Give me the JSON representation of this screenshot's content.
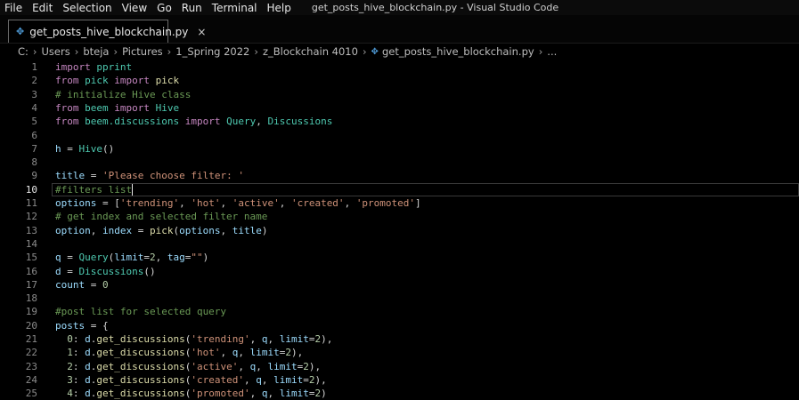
{
  "menu": [
    "File",
    "Edit",
    "Selection",
    "View",
    "Go",
    "Run",
    "Terminal",
    "Help"
  ],
  "window_title": "get_posts_hive_blockchain.py - Visual Studio Code",
  "tab": {
    "label": "get_posts_hive_blockchain.py",
    "close": "×",
    "icon": "python-file-icon"
  },
  "breadcrumb": [
    "C:",
    "Users",
    "bteja",
    "Pictures",
    "1_Spring 2022",
    "z_Blockchain 4010",
    "get_posts_hive_blockchain.py",
    "..."
  ],
  "colors": {
    "keyword": "#c586c0",
    "function": "#dcdcaa",
    "string": "#ce9178",
    "comment": "#6a9955",
    "number": "#b5cea8",
    "variable": "#9cdcfe",
    "class": "#4ec9b0"
  },
  "active_line": 10,
  "lines": [
    {
      "n": "1",
      "tokens": [
        [
          "kw",
          "import"
        ],
        [
          "plain",
          " "
        ],
        [
          "mod",
          "pprint"
        ]
      ]
    },
    {
      "n": "2",
      "tokens": [
        [
          "kw",
          "from"
        ],
        [
          "plain",
          " "
        ],
        [
          "mod",
          "pick"
        ],
        [
          "plain",
          " "
        ],
        [
          "kw",
          "import"
        ],
        [
          "plain",
          " "
        ],
        [
          "fn",
          "pick"
        ]
      ]
    },
    {
      "n": "3",
      "tokens": [
        [
          "cm",
          "# initialize Hive class"
        ]
      ]
    },
    {
      "n": "4",
      "tokens": [
        [
          "kw",
          "from"
        ],
        [
          "plain",
          " "
        ],
        [
          "mod",
          "beem"
        ],
        [
          "plain",
          " "
        ],
        [
          "kw",
          "import"
        ],
        [
          "plain",
          " "
        ],
        [
          "cls",
          "Hive"
        ]
      ]
    },
    {
      "n": "5",
      "tokens": [
        [
          "kw",
          "from"
        ],
        [
          "plain",
          " "
        ],
        [
          "mod",
          "beem.discussions"
        ],
        [
          "plain",
          " "
        ],
        [
          "kw",
          "import"
        ],
        [
          "plain",
          " "
        ],
        [
          "cls",
          "Query"
        ],
        [
          "plain",
          ", "
        ],
        [
          "cls",
          "Discussions"
        ]
      ]
    },
    {
      "n": "6",
      "tokens": []
    },
    {
      "n": "7",
      "tokens": [
        [
          "var",
          "h"
        ],
        [
          "plain",
          " = "
        ],
        [
          "cls",
          "Hive"
        ],
        [
          "plain",
          "()"
        ]
      ]
    },
    {
      "n": "8",
      "tokens": []
    },
    {
      "n": "9",
      "tokens": [
        [
          "var",
          "title"
        ],
        [
          "plain",
          " = "
        ],
        [
          "str",
          "'Please choose filter: '"
        ]
      ]
    },
    {
      "n": "10",
      "tokens": [
        [
          "cm",
          "#filters list"
        ]
      ]
    },
    {
      "n": "11",
      "tokens": [
        [
          "var",
          "options"
        ],
        [
          "plain",
          " = ["
        ],
        [
          "str",
          "'trending'"
        ],
        [
          "plain",
          ", "
        ],
        [
          "str",
          "'hot'"
        ],
        [
          "plain",
          ", "
        ],
        [
          "str",
          "'active'"
        ],
        [
          "plain",
          ", "
        ],
        [
          "str",
          "'created'"
        ],
        [
          "plain",
          ", "
        ],
        [
          "str",
          "'promoted'"
        ],
        [
          "plain",
          "]"
        ]
      ]
    },
    {
      "n": "12",
      "tokens": [
        [
          "cm",
          "# get index and selected filter name"
        ]
      ]
    },
    {
      "n": "13",
      "tokens": [
        [
          "var",
          "option"
        ],
        [
          "plain",
          ", "
        ],
        [
          "var",
          "index"
        ],
        [
          "plain",
          " = "
        ],
        [
          "fn",
          "pick"
        ],
        [
          "plain",
          "("
        ],
        [
          "var",
          "options"
        ],
        [
          "plain",
          ", "
        ],
        [
          "var",
          "title"
        ],
        [
          "plain",
          ")"
        ]
      ]
    },
    {
      "n": "14",
      "tokens": []
    },
    {
      "n": "15",
      "tokens": [
        [
          "var",
          "q"
        ],
        [
          "plain",
          " = "
        ],
        [
          "cls",
          "Query"
        ],
        [
          "plain",
          "("
        ],
        [
          "var",
          "limit"
        ],
        [
          "plain",
          "="
        ],
        [
          "num",
          "2"
        ],
        [
          "plain",
          ", "
        ],
        [
          "var",
          "tag"
        ],
        [
          "plain",
          "="
        ],
        [
          "str",
          "\"\""
        ],
        [
          "plain",
          ")"
        ]
      ]
    },
    {
      "n": "16",
      "tokens": [
        [
          "var",
          "d"
        ],
        [
          "plain",
          " = "
        ],
        [
          "cls",
          "Discussions"
        ],
        [
          "plain",
          "()"
        ]
      ]
    },
    {
      "n": "17",
      "tokens": [
        [
          "var",
          "count"
        ],
        [
          "plain",
          " = "
        ],
        [
          "num",
          "0"
        ]
      ]
    },
    {
      "n": "18",
      "tokens": []
    },
    {
      "n": "19",
      "tokens": [
        [
          "cm",
          "#post list for selected query"
        ]
      ]
    },
    {
      "n": "20",
      "tokens": [
        [
          "var",
          "posts"
        ],
        [
          "plain",
          " = {"
        ]
      ]
    },
    {
      "n": "21",
      "tokens": [
        [
          "plain",
          "  "
        ],
        [
          "num",
          "0"
        ],
        [
          "plain",
          ": "
        ],
        [
          "var",
          "d"
        ],
        [
          "plain",
          "."
        ],
        [
          "fn",
          "get_discussions"
        ],
        [
          "plain",
          "("
        ],
        [
          "str",
          "'trending'"
        ],
        [
          "plain",
          ", "
        ],
        [
          "var",
          "q"
        ],
        [
          "plain",
          ", "
        ],
        [
          "var",
          "limit"
        ],
        [
          "plain",
          "="
        ],
        [
          "num",
          "2"
        ],
        [
          "plain",
          "),"
        ]
      ]
    },
    {
      "n": "22",
      "tokens": [
        [
          "plain",
          "  "
        ],
        [
          "num",
          "1"
        ],
        [
          "plain",
          ": "
        ],
        [
          "var",
          "d"
        ],
        [
          "plain",
          "."
        ],
        [
          "fn",
          "get_discussions"
        ],
        [
          "plain",
          "("
        ],
        [
          "str",
          "'hot'"
        ],
        [
          "plain",
          ", "
        ],
        [
          "var",
          "q"
        ],
        [
          "plain",
          ", "
        ],
        [
          "var",
          "limit"
        ],
        [
          "plain",
          "="
        ],
        [
          "num",
          "2"
        ],
        [
          "plain",
          "),"
        ]
      ]
    },
    {
      "n": "23",
      "tokens": [
        [
          "plain",
          "  "
        ],
        [
          "num",
          "2"
        ],
        [
          "plain",
          ": "
        ],
        [
          "var",
          "d"
        ],
        [
          "plain",
          "."
        ],
        [
          "fn",
          "get_discussions"
        ],
        [
          "plain",
          "("
        ],
        [
          "str",
          "'active'"
        ],
        [
          "plain",
          ", "
        ],
        [
          "var",
          "q"
        ],
        [
          "plain",
          ", "
        ],
        [
          "var",
          "limit"
        ],
        [
          "plain",
          "="
        ],
        [
          "num",
          "2"
        ],
        [
          "plain",
          "),"
        ]
      ]
    },
    {
      "n": "24",
      "tokens": [
        [
          "plain",
          "  "
        ],
        [
          "num",
          "3"
        ],
        [
          "plain",
          ": "
        ],
        [
          "var",
          "d"
        ],
        [
          "plain",
          "."
        ],
        [
          "fn",
          "get_discussions"
        ],
        [
          "plain",
          "("
        ],
        [
          "str",
          "'created'"
        ],
        [
          "plain",
          ", "
        ],
        [
          "var",
          "q"
        ],
        [
          "plain",
          ", "
        ],
        [
          "var",
          "limit"
        ],
        [
          "plain",
          "="
        ],
        [
          "num",
          "2"
        ],
        [
          "plain",
          "),"
        ]
      ]
    },
    {
      "n": "25",
      "tokens": [
        [
          "plain",
          "  "
        ],
        [
          "num",
          "4"
        ],
        [
          "plain",
          ": "
        ],
        [
          "var",
          "d"
        ],
        [
          "plain",
          "."
        ],
        [
          "fn",
          "get_discussions"
        ],
        [
          "plain",
          "("
        ],
        [
          "str",
          "'promoted'"
        ],
        [
          "plain",
          ", "
        ],
        [
          "var",
          "q"
        ],
        [
          "plain",
          ", "
        ],
        [
          "var",
          "limit"
        ],
        [
          "plain",
          "="
        ],
        [
          "num",
          "2"
        ],
        [
          "plain",
          ")"
        ]
      ]
    }
  ]
}
